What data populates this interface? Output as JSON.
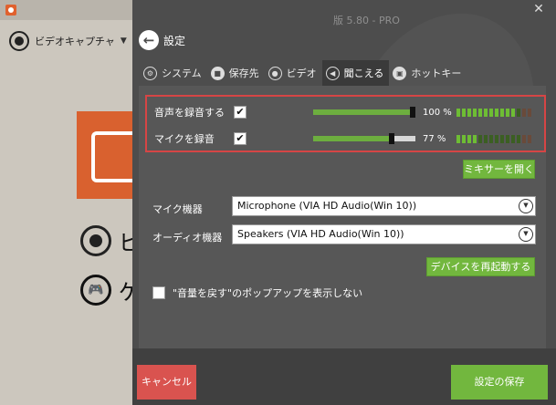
{
  "background": {
    "mode_label": "ビデオキャプチャ",
    "caret": "▼",
    "record_label": "ビ",
    "game_label": "ゲ"
  },
  "panel": {
    "close_glyph": "✕",
    "version": "版 5.80 - PRO",
    "back_glyph": "←",
    "title": "設定",
    "tabs": [
      {
        "label": "システム",
        "icon": "gear-icon",
        "glyph": "⚙"
      },
      {
        "label": "保存先",
        "icon": "folder-icon",
        "glyph": "■"
      },
      {
        "label": "ビデオ",
        "icon": "video-icon",
        "glyph": "●"
      },
      {
        "label": "聞こえる",
        "icon": "speaker-icon",
        "glyph": "◀"
      },
      {
        "label": "ホットキー",
        "icon": "hotkey-icon",
        "glyph": "▣"
      }
    ],
    "active_tab": 3
  },
  "audio": {
    "system": {
      "label": "音声を録音する",
      "checked": true,
      "check_glyph": "✔",
      "volume_percent": 100,
      "volume_text": "100 %",
      "meter_segments": 14,
      "meter_active": 11
    },
    "mic": {
      "label": "マイクを録音",
      "checked": true,
      "check_glyph": "✔",
      "volume_percent": 77,
      "volume_text": "77 %",
      "meter_segments": 14,
      "meter_active": 4
    },
    "mixer_button": "ミキサーを開く"
  },
  "devices": {
    "mic_label": "マイク機器",
    "mic_value": "Microphone (VIA HD Audio(Win 10))",
    "audio_label": "オーディオ機器",
    "audio_value": "Speakers (VIA HD Audio(Win 10))",
    "dropdown_glyph": "▼",
    "restart_button": "デバイスを再起動する"
  },
  "popup_option": {
    "label": "\"音量を戻す\"のポップアップを表示しない",
    "checked": false
  },
  "footer": {
    "cancel": "キャンセル",
    "save": "設定の保存"
  },
  "colors": {
    "accent_green": "#72b73e",
    "danger_red": "#d9534f",
    "highlight_border": "#d64545",
    "panel_bg": "#4d4d4d"
  }
}
